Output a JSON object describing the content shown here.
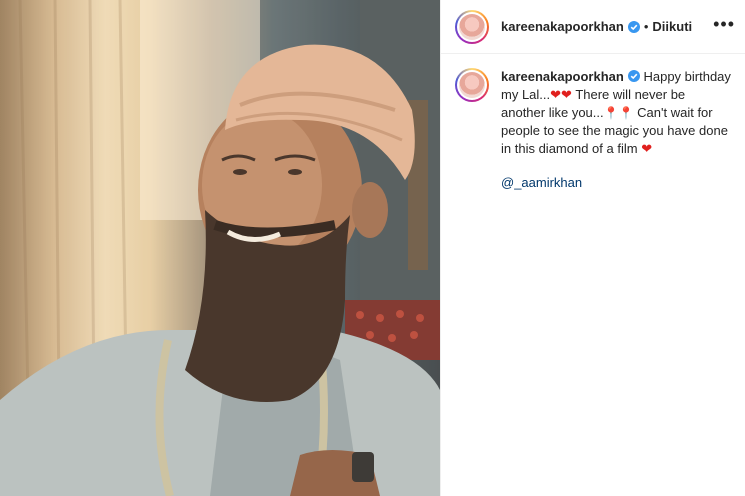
{
  "post": {
    "username": "kareenakapoorkhan",
    "follow_separator": "•",
    "follow_label": "Diikuti",
    "more_label": "•••"
  },
  "caption": {
    "username": "kareenakapoorkhan",
    "line1": "Happy birthday my Lal...",
    "line2": "There will never be another like you...",
    "line3": "Can't wait for people to see the magic you have done in this diamond of a film",
    "mention": "@_aamirkhan",
    "heart_glyph": "❤",
    "pin_glyph": "📍"
  },
  "colors": {
    "verified": "#3897f0",
    "heart": "#e0201e",
    "mention": "#00376b"
  }
}
